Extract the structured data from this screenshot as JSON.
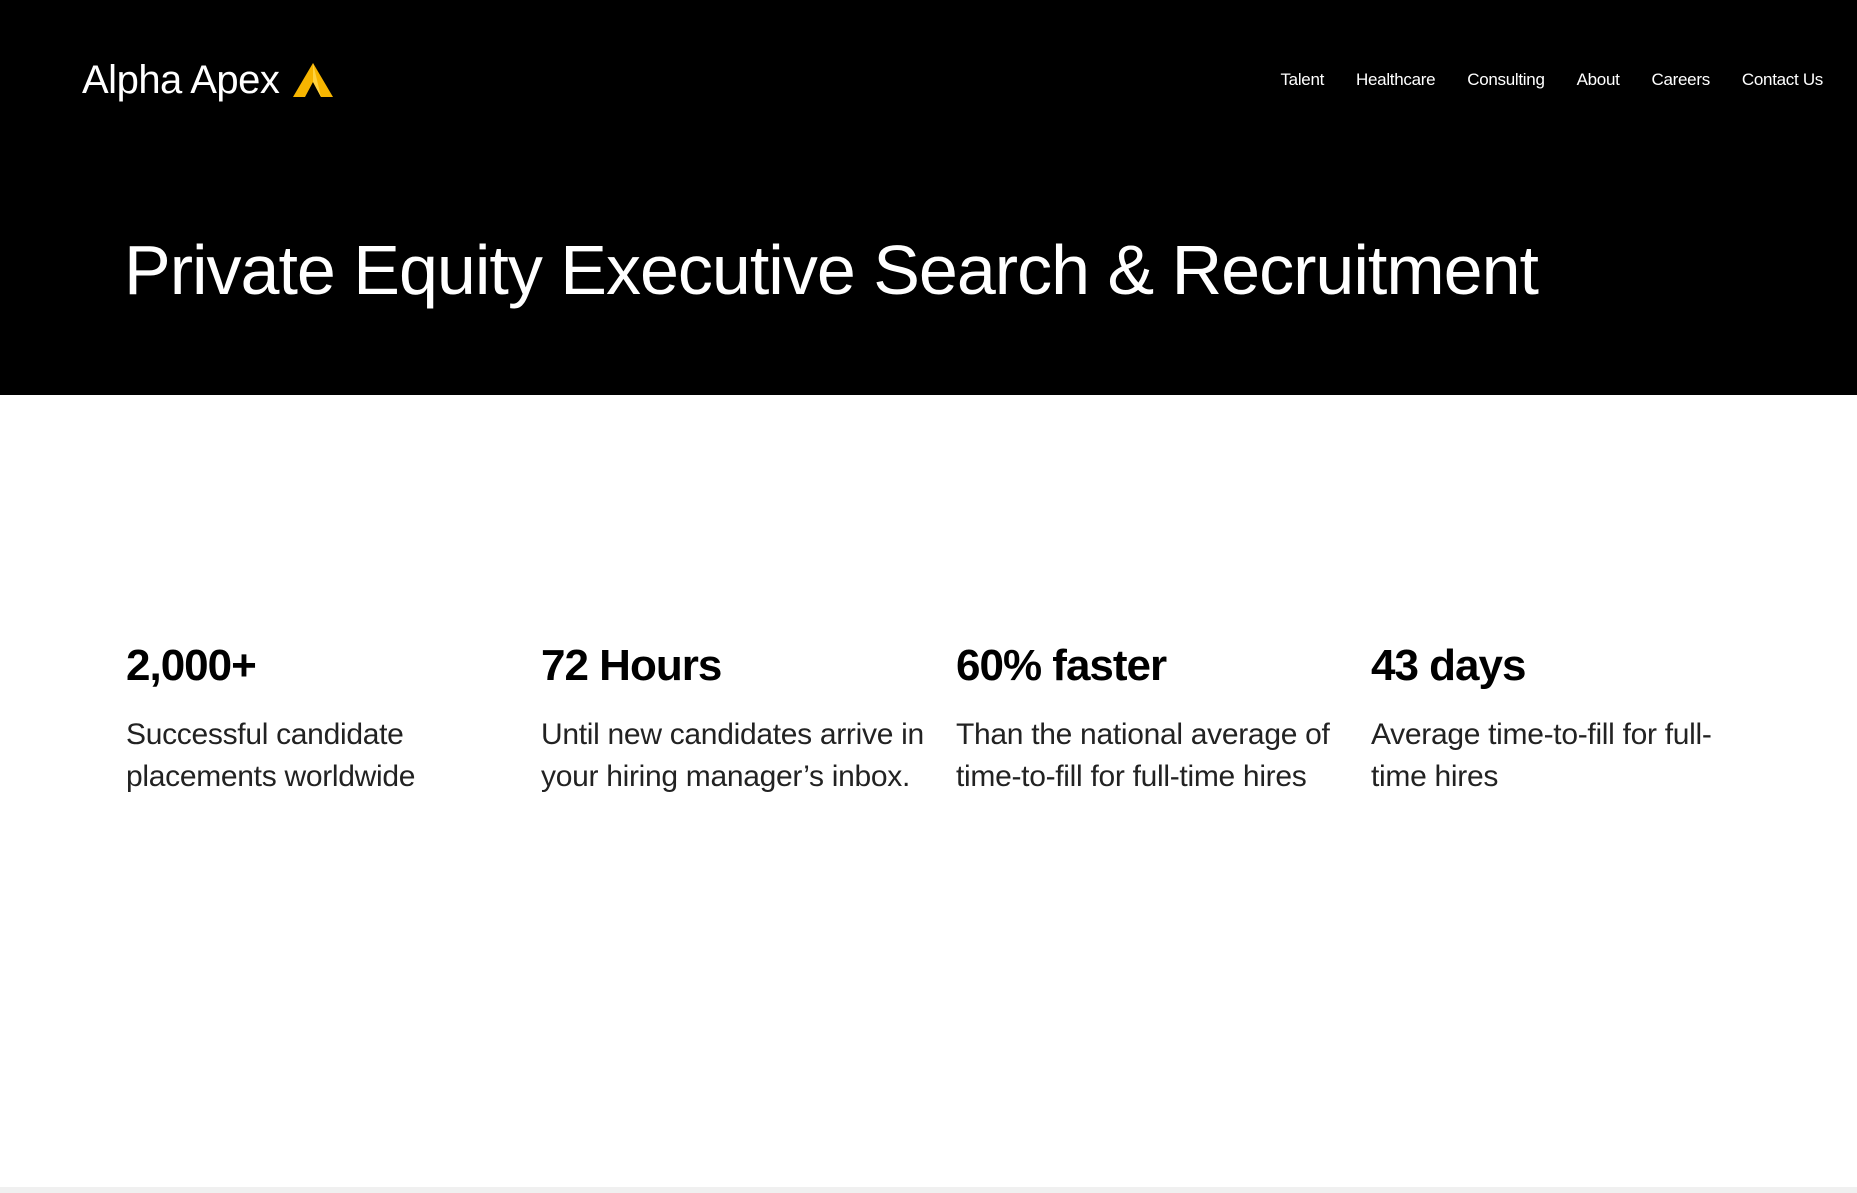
{
  "brand": {
    "name": "Alpha Apex",
    "mark_colors": {
      "outer": "#F7B500",
      "inner": "#FFE36A"
    }
  },
  "nav": {
    "items": [
      {
        "label": "Talent"
      },
      {
        "label": "Healthcare"
      },
      {
        "label": "Consulting"
      },
      {
        "label": "About"
      },
      {
        "label": "Careers"
      },
      {
        "label": "Contact Us"
      }
    ]
  },
  "hero": {
    "title": "Private Equity Executive Search & Recruitment",
    "background": "#000000"
  },
  "stats": [
    {
      "value": "2,000+",
      "description": "Successful candidate placements worldwide"
    },
    {
      "value": "72 Hours",
      "description": "Until new candidates arrive in your hiring manager’s inbox."
    },
    {
      "value": "60% faster",
      "description": "Than the national average of time-to-fill for full-time hires"
    },
    {
      "value": "43 days",
      "description": "Average time-to-fill for full-time hires"
    }
  ]
}
